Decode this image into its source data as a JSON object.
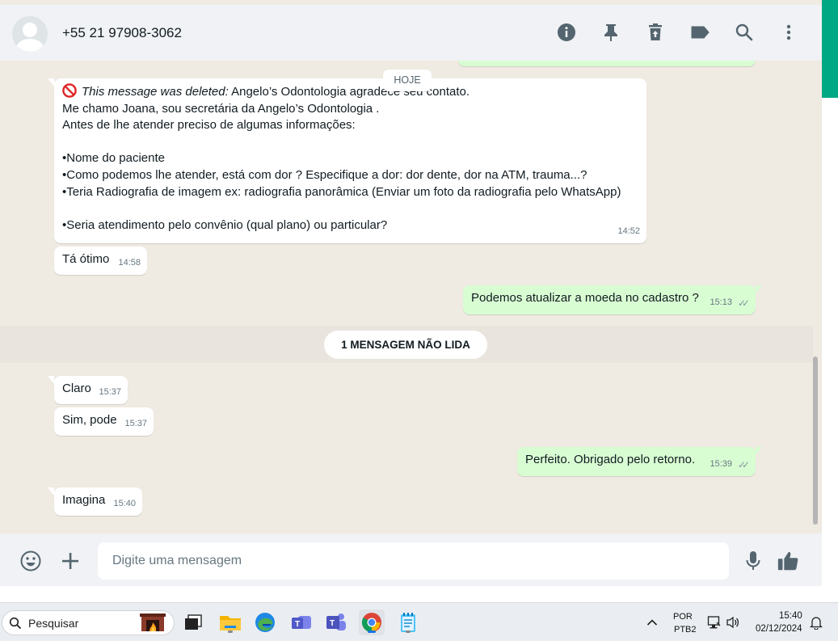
{
  "header": {
    "contact_name": "+55 21 97908-3062",
    "icons": [
      "info-icon",
      "pin-icon",
      "delete-icon",
      "label-icon",
      "search-icon",
      "menu-icon"
    ]
  },
  "chat": {
    "date_chip": "HOJE",
    "messages": [
      {
        "direction": "in",
        "deleted_label": "This message was deleted:",
        "lines": [
          "Angelo’s Odontologia agradece seu contato.",
          "Me chamo Joana, sou secretária da Angelo’s Odontologia .",
          "Antes de lhe atender preciso de algumas informações:",
          "",
          "•Nome do paciente",
          "•Como podemos lhe atender, está com dor ? Especifique a dor: dor dente, dor na ATM, trauma...?",
          "•Teria Radiografia de imagem ex: radiografia panorâmica (Enviar um foto da radiografia pelo WhatsApp)",
          "",
          "•Seria atendimento pelo convênio (qual plano) ou particular?"
        ],
        "time": "14:52"
      },
      {
        "direction": "in",
        "text": "Tá ótimo",
        "time": "14:58"
      },
      {
        "direction": "out",
        "text": "Podemos atualizar a moeda no cadastro ?",
        "time": "15:13"
      },
      {
        "direction": "in",
        "text": "Claro",
        "time": "15:37"
      },
      {
        "direction": "in",
        "text": "Sim, pode",
        "time": "15:37"
      },
      {
        "direction": "out",
        "text": "Perfeito. Obrigado pelo retorno.",
        "time": "15:39"
      },
      {
        "direction": "in",
        "text": "Imagina",
        "time": "15:40"
      }
    ],
    "unread_label": "1 MENSAGEM NÃO LIDA",
    "read_ticks": "✓✓"
  },
  "composer": {
    "placeholder": "Digite uma mensagem"
  },
  "taskbar": {
    "search_placeholder": "Pesquisar",
    "lang_line1": "POR",
    "lang_line2": "PTB2",
    "time": "15:40",
    "date": "02/12/2024"
  },
  "colors": {
    "accent": "#00a884",
    "outgoing_bubble": "#d9fdd3",
    "chat_background": "#efeae2"
  }
}
